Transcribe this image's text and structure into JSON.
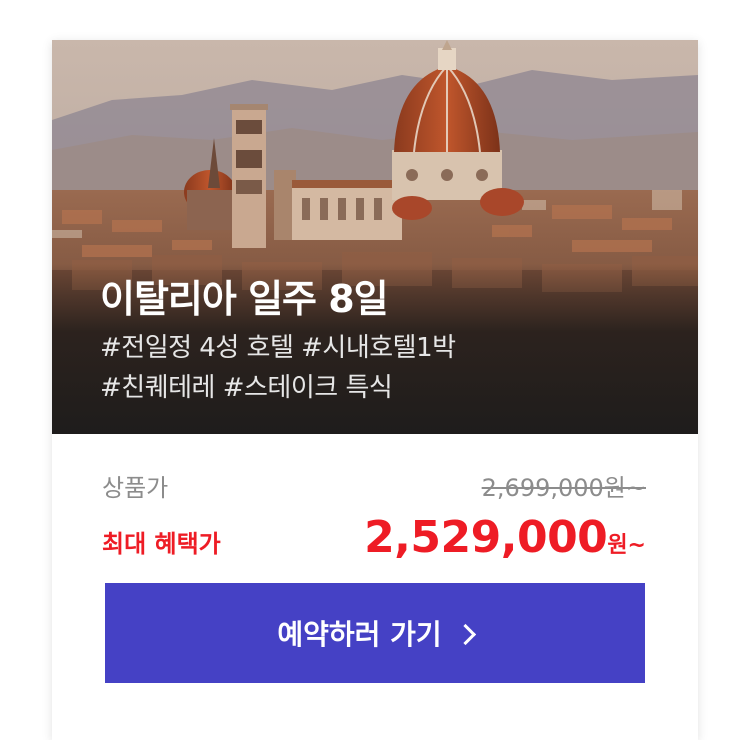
{
  "tour": {
    "title": "이탈리아 일주 8일",
    "tags_line1": "#전일정 4성 호텔 #시내호텔1박",
    "tags_line2": "#친퀘테레 #스테이크 특식"
  },
  "pricing": {
    "normal_label": "상품가",
    "normal_price": "2,699,000원~",
    "benefit_label": "최대 혜택가",
    "benefit_price": "2,529,000",
    "benefit_unit": "원~"
  },
  "cta": {
    "label": "예약하러 가기",
    "icon": "chevron-right-icon"
  },
  "colors": {
    "accent_red": "#ee1c25",
    "button_bg": "#4541c5",
    "muted_text": "#8c8c8c"
  }
}
